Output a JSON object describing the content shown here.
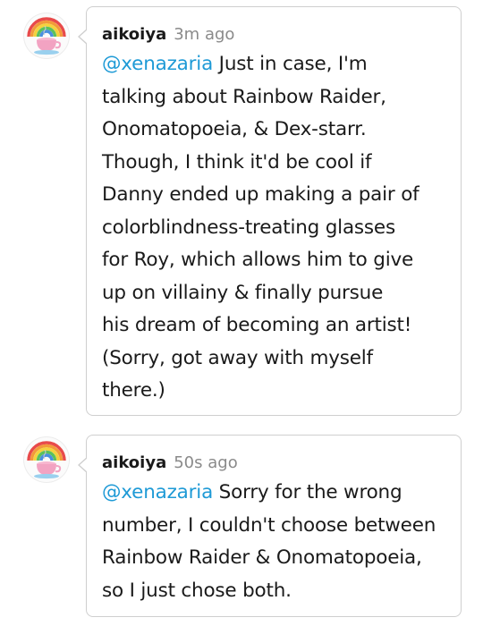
{
  "replies": [
    {
      "avatar_icon": "rainbow-teacup-icon",
      "username": "aikoiya",
      "timestamp": "3m ago",
      "mention": "@xenazaria",
      "lines": [
        " Just in case, I'm",
        "talking about Rainbow Raider,",
        "Onomatopoeia, & Dex-starr.",
        "Though, I think it'd be cool if",
        "Danny ended up making a pair of",
        "colorblindness-treating glasses",
        "for Roy, which allows him to give",
        "up on villainy & finally pursue",
        "his dream of becoming an artist!",
        "(Sorry, got away with myself",
        "there.)"
      ]
    },
    {
      "avatar_icon": "rainbow-teacup-icon",
      "username": "aikoiya",
      "timestamp": "50s ago",
      "mention": "@xenazaria",
      "lines": [
        " Sorry for the wrong",
        "number, I couldn't choose between",
        "Rainbow Raider & Onomatopoeia,",
        "so I just chose both."
      ]
    }
  ],
  "colors": {
    "mention": "#1e9ad6",
    "timestamp": "#8a8a8a",
    "bubble_border": "#cfcfcf"
  }
}
